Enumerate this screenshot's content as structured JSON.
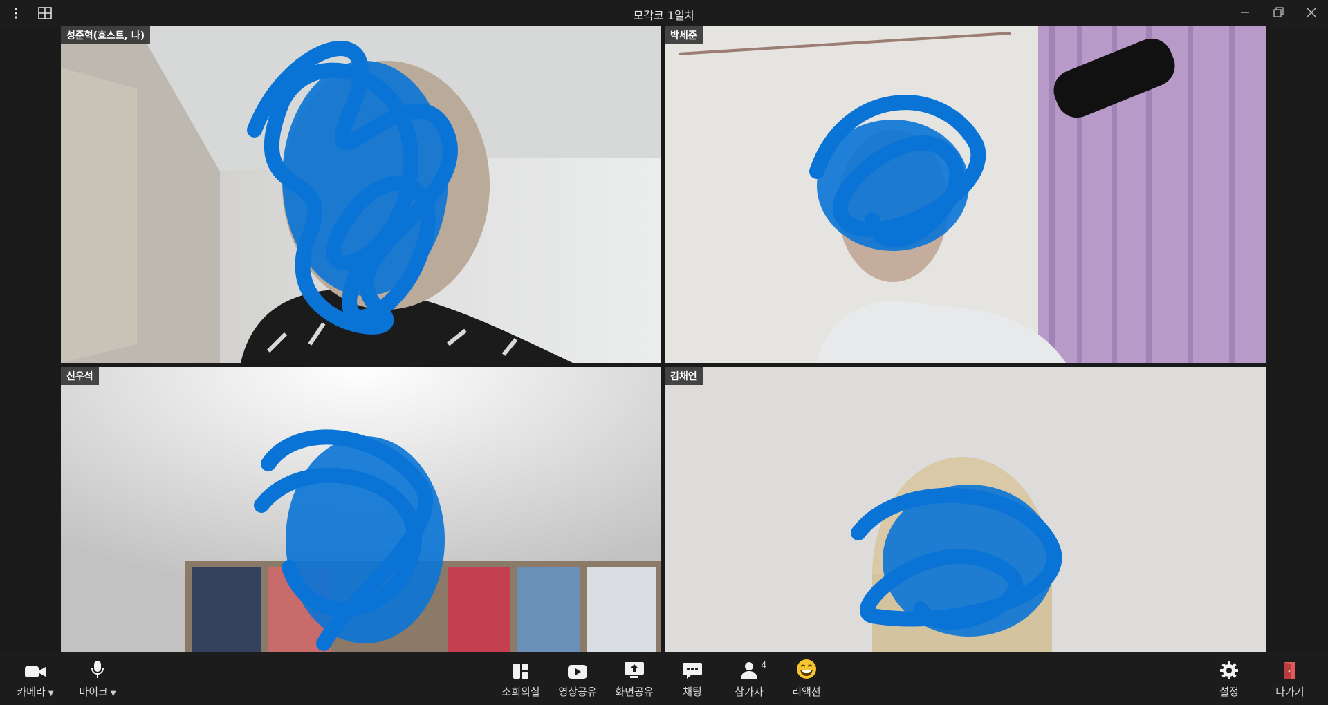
{
  "window": {
    "title": "모각코 1일차"
  },
  "participants": [
    {
      "name": "성준혁(호스트, 나)",
      "active": true
    },
    {
      "name": "박세준",
      "active": false
    },
    {
      "name": "신우석",
      "active": false
    },
    {
      "name": "김채연",
      "active": false
    }
  ],
  "toolbar": {
    "camera_label": "카메라",
    "mic_label": "마이크",
    "breakout_label": "소회의실",
    "video_share_label": "영상공유",
    "screen_share_label": "화면공유",
    "chat_label": "채팅",
    "participants_label": "참가자",
    "participants_count": "4",
    "reaction_label": "리액션",
    "settings_label": "설정",
    "leave_label": "나가기"
  },
  "colors": {
    "active_border": "#4fd1b0",
    "scribble": "#0a74d6",
    "leave_icon": "#e05a5a"
  }
}
